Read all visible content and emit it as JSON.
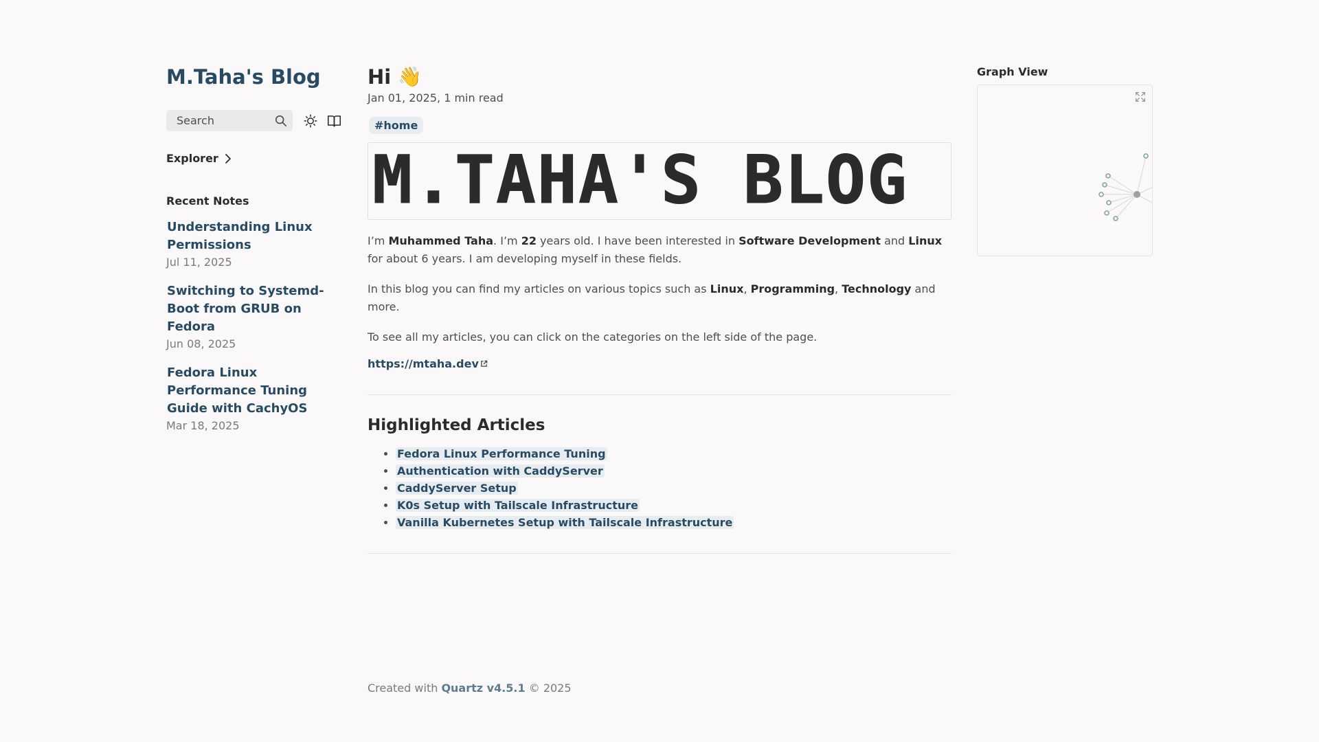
{
  "site": {
    "title": "M.Taha's Blog"
  },
  "search": {
    "label": "Search"
  },
  "explorer": {
    "label": "Explorer"
  },
  "recent": {
    "title": "Recent Notes",
    "items": [
      {
        "title": "Understanding Linux Permissions",
        "date": "Jul 11, 2025"
      },
      {
        "title": "Switching to Systemd-Boot from GRUB on Fedora",
        "date": "Jun 08, 2025"
      },
      {
        "title": "Fedora Linux Performance Tuning Guide with CachyOS",
        "date": "Mar 18, 2025"
      }
    ]
  },
  "post": {
    "title": "Hi",
    "emoji": "👋",
    "date": "Jan 01, 2025,",
    "read_time": "1 min read",
    "tag": "#home",
    "banner_text": "M.TAHA'S BLOG",
    "p1": {
      "a": "I’m ",
      "name": "Muhammed Taha",
      "b": ". I’m ",
      "age": "22",
      "c": " years old. I have been interested in ",
      "sd": "Software Development",
      "d": " and ",
      "linux": "Linux",
      "e": " for about 6 years. I am developing myself in these fields."
    },
    "p2": {
      "a": "In this blog you can find my articles on various topics such as ",
      "t1": "Linux",
      "s1": ", ",
      "t2": "Programming",
      "s2": ", ",
      "t3": "Technology",
      "b": " and more."
    },
    "p3": "To see all my articles, you can click on the categories on the left side of the page.",
    "link": "https://mtaha.dev"
  },
  "highlights": {
    "title": "Highlighted Articles",
    "items": [
      "Fedora Linux Performance Tuning",
      "Authentication with CaddyServer",
      "CaddyServer Setup",
      "K0s Setup with Tailscale Infrastructure",
      "Vanilla Kubernetes Setup with Tailscale Infrastructure"
    ]
  },
  "graph": {
    "title": "Graph View"
  },
  "footer": {
    "prefix": "Created with ",
    "link": "Quartz v4.5.1",
    "suffix": " © 2025"
  },
  "colors": {
    "accent": "#284b63",
    "background": "#faf8f8",
    "highlight": "#e6ecef",
    "graph_node": "#84a59d"
  },
  "icons": {
    "search": "search-icon",
    "theme": "sun-icon",
    "reader": "book-icon",
    "explorer": "chevron-right-icon",
    "graph": "expand-icon",
    "external": "external-link-icon"
  }
}
